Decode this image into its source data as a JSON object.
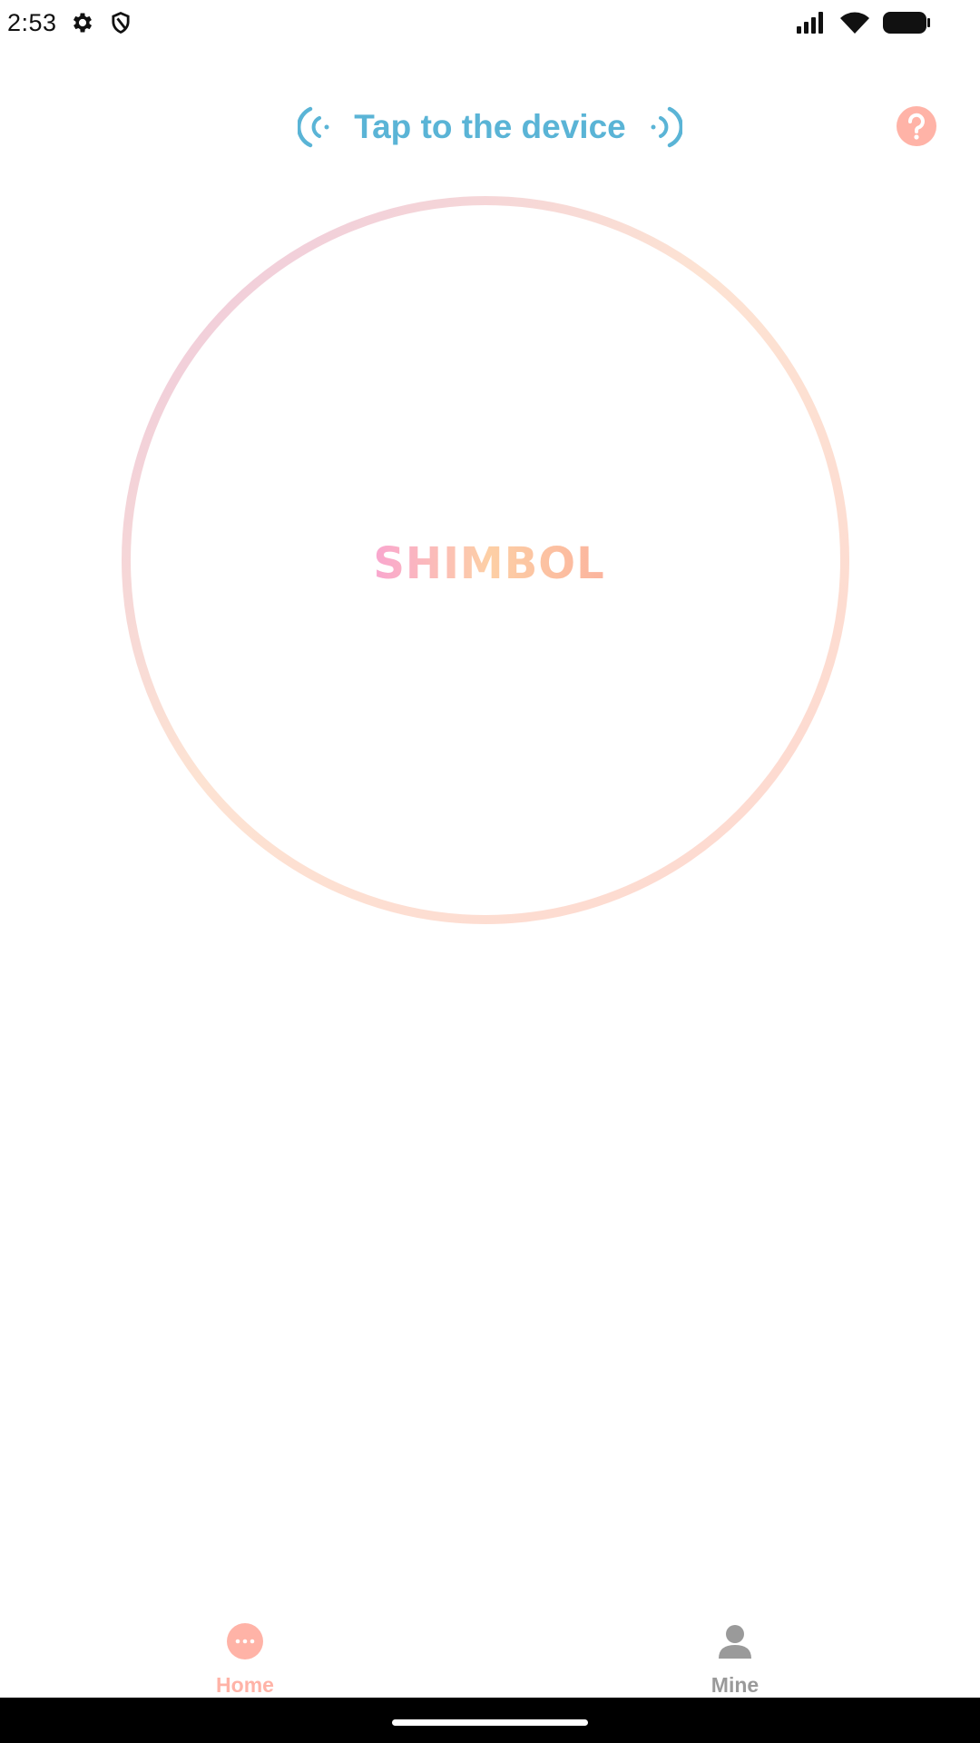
{
  "status_bar": {
    "time": "2:53",
    "icons": [
      "gear-icon",
      "shield-icon",
      "signal-icon",
      "wifi-icon",
      "battery-icon"
    ]
  },
  "header": {
    "title": "Tap to the device",
    "help_icon": "question-circle-icon",
    "title_color": "#5ab4d6",
    "help_color": "#ffb3a7"
  },
  "main": {
    "brand_logo": "SHIMBOL"
  },
  "bottom_nav": {
    "items": [
      {
        "label": "Home",
        "icon": "chat-dots-icon",
        "active": true
      },
      {
        "label": "Mine",
        "icon": "user-icon",
        "active": false
      }
    ],
    "active_color": "#ffb3a7",
    "inactive_color": "#9a9a9a"
  }
}
